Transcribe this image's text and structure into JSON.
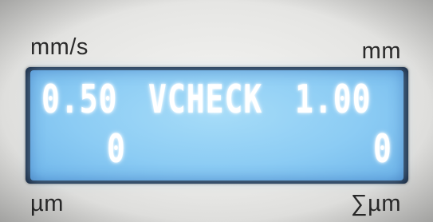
{
  "labels": {
    "top_left": "mm/s",
    "top_right": "mm",
    "bottom_left": "µm",
    "bottom_right": "∑µm"
  },
  "display": {
    "row1": {
      "speed": "0.50",
      "mode": "VCHECK",
      "distance": "1.00"
    },
    "row2": {
      "counter_left": "0",
      "counter_right": "0"
    }
  },
  "colors": {
    "lcd_background": "#8cccf4",
    "lcd_text": "#ffffff",
    "panel": "#e6e6e4",
    "label_text": "#2a2a2a"
  }
}
